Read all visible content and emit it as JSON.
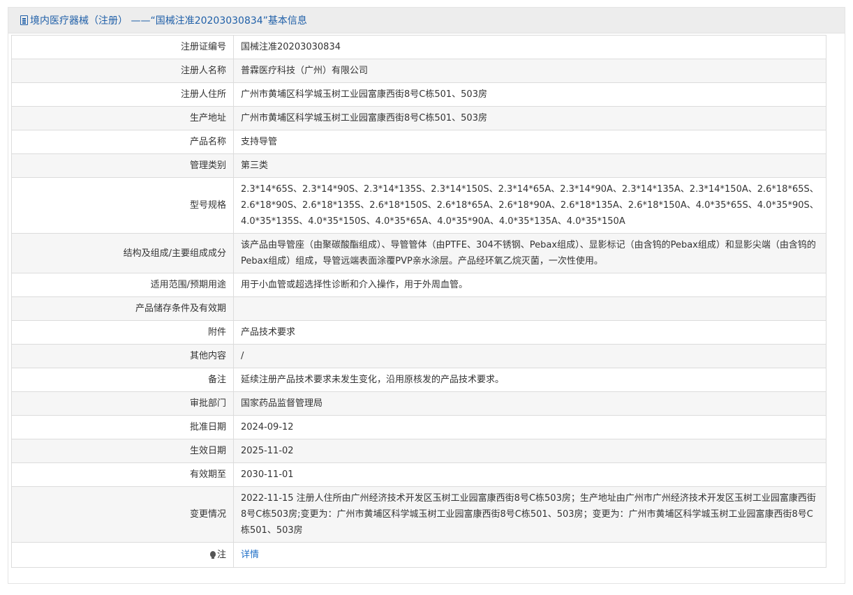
{
  "header": {
    "title": "境内医疗器械（注册） ——“国械注准20203030834”基本信息"
  },
  "rows": [
    {
      "label": "注册证编号",
      "value": "国械注准20203030834"
    },
    {
      "label": "注册人名称",
      "value": "普霖医疗科技（广州）有限公司"
    },
    {
      "label": "注册人住所",
      "value": "广州市黄埔区科学城玉树工业园富康西街8号C栋501、503房"
    },
    {
      "label": "生产地址",
      "value": "广州市黄埔区科学城玉树工业园富康西街8号C栋501、503房"
    },
    {
      "label": "产品名称",
      "value": "支持导管"
    },
    {
      "label": "管理类别",
      "value": "第三类"
    },
    {
      "label": "型号规格",
      "value": "2.3*14*65S、2.3*14*90S、2.3*14*135S、2.3*14*150S、2.3*14*65A、2.3*14*90A、2.3*14*135A、2.3*14*150A、2.6*18*65S、2.6*18*90S、2.6*18*135S、2.6*18*150S、2.6*18*65A、2.6*18*90A、2.6*18*135A、2.6*18*150A、4.0*35*65S、4.0*35*90S、4.0*35*135S、4.0*35*150S、4.0*35*65A、4.0*35*90A、4.0*35*135A、4.0*35*150A"
    },
    {
      "label": "结构及组成/主要组成成分",
      "value": "该产品由导管座（由聚碳酸酯组成）、导管管体（由PTFE、304不锈钢、Pebax组成）、显影标记（由含钨的Pebax组成）和显影尖端（由含钨的Pebax组成）组成，导管远端表面涂覆PVP亲水涂层。产品经环氧乙烷灭菌，一次性使用。"
    },
    {
      "label": "适用范围/预期用途",
      "value": "用于小血管或超选择性诊断和介入操作，用于外周血管。"
    },
    {
      "label": "产品储存条件及有效期",
      "value": ""
    },
    {
      "label": "附件",
      "value": "产品技术要求"
    },
    {
      "label": "其他内容",
      "value": "/"
    },
    {
      "label": "备注",
      "value": "延续注册产品技术要求未发生变化，沿用原核发的产品技术要求。"
    },
    {
      "label": "审批部门",
      "value": "国家药品监督管理局"
    },
    {
      "label": "批准日期",
      "value": "2024-09-12"
    },
    {
      "label": "生效日期",
      "value": "2025-11-02"
    },
    {
      "label": "有效期至",
      "value": "2030-11-01"
    },
    {
      "label": "变更情况",
      "value": "2022-11-15 注册人住所由广州经济技术开发区玉树工业园富康西街8号C栋503房；生产地址由广州市广州经济技术开发区玉树工业园富康西街8号C栋503房;变更为：广州市黄埔区科学城玉树工业园富康西街8号C栋501、503房；变更为：广州市黄埔区科学城玉树工业园富康西街8号C栋501、503房"
    }
  ],
  "note_row": {
    "label": "注",
    "link": "详情"
  }
}
